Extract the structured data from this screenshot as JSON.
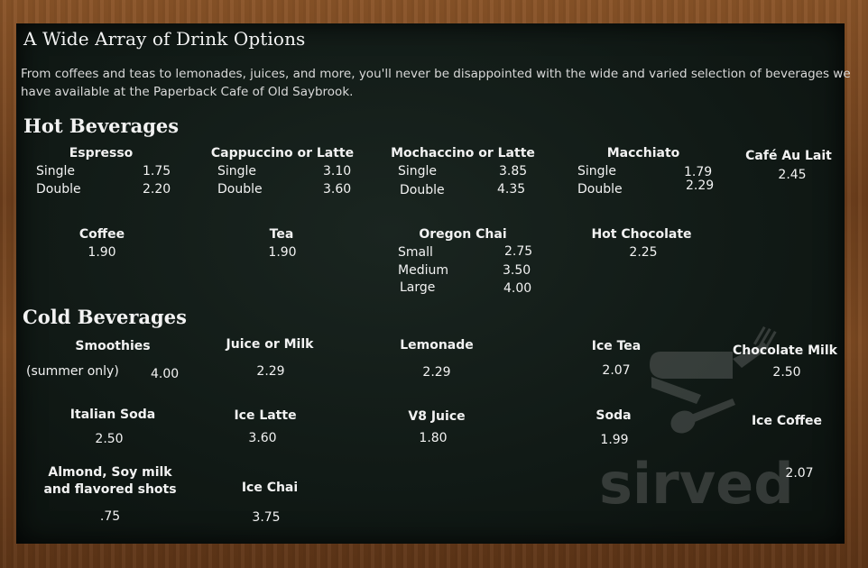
{
  "title": "A Wide Array of Drink Options",
  "intro": "From coffees and teas to lemonades, juices, and more, you'll never be disappointed with the wide and varied selection of beverages we have available at the Paperback Cafe of Old Saybrook.",
  "hot": {
    "heading": "Hot Beverages",
    "espresso": {
      "name": "Espresso",
      "r1l": "Single",
      "r1p": "1.75",
      "r2l": "Double",
      "r2p": "2.20"
    },
    "cappuccino": {
      "name": "Cappuccino or Latte",
      "r1l": "Single",
      "r1p": "3.10",
      "r2l": "Double",
      "r2p": "3.60"
    },
    "mochaccino": {
      "name": "Mochaccino or Latte",
      "r1l": "Single",
      "r1p": "3.85",
      "r2l": "Double",
      "r2p": "4.35"
    },
    "macchiato": {
      "name": "Macchiato",
      "r1l": "Single",
      "r1p": "1.79",
      "r2l": "Double",
      "r2p": "2.29"
    },
    "cafe_au_lait": {
      "name": "Café Au Lait",
      "price": "2.45"
    },
    "coffee": {
      "name": "Coffee",
      "price": "1.90"
    },
    "tea": {
      "name": "Tea",
      "price": "1.90"
    },
    "chai": {
      "name": "Oregon Chai",
      "r1l": "Small",
      "r1p": "2.75",
      "r2l": "Medium",
      "r2p": "3.50",
      "r3l": "Large",
      "r3p": "4.00"
    },
    "hot_chocolate": {
      "name": "Hot Chocolate",
      "price": "2.25"
    }
  },
  "cold": {
    "heading": "Cold Beverages",
    "smoothies": {
      "name": "Smoothies",
      "note": "(summer only)",
      "price": "4.00"
    },
    "juice_milk": {
      "name": "Juice or Milk",
      "price": "2.29"
    },
    "lemonade": {
      "name": "Lemonade",
      "price": "2.29"
    },
    "ice_tea": {
      "name": "Ice Tea",
      "price": "2.07"
    },
    "chocolate_milk": {
      "name": "Chocolate Milk",
      "price": "2.50"
    },
    "italian_soda": {
      "name": "Italian Soda",
      "price": "2.50"
    },
    "ice_latte": {
      "name": "Ice Latte",
      "price": "3.60"
    },
    "v8": {
      "name": "V8 Juice",
      "price": "1.80"
    },
    "soda": {
      "name": "Soda",
      "price": "1.99"
    },
    "ice_coffee": {
      "name": "Ice Coffee",
      "price": "2.07"
    },
    "almond": {
      "name_line1": "Almond, Soy milk",
      "name_line2": "and flavored shots",
      "price": ".75"
    },
    "ice_chai": {
      "name": "Ice Chai",
      "price": "3.75"
    }
  },
  "watermark": {
    "text": "sirved",
    "icon": "swiss-knife-cutlery-icon",
    "color": "#9a9a9a"
  },
  "colors": {
    "board": "#111a16",
    "frame": "#7a4a22",
    "text": "#f2f2f2"
  }
}
